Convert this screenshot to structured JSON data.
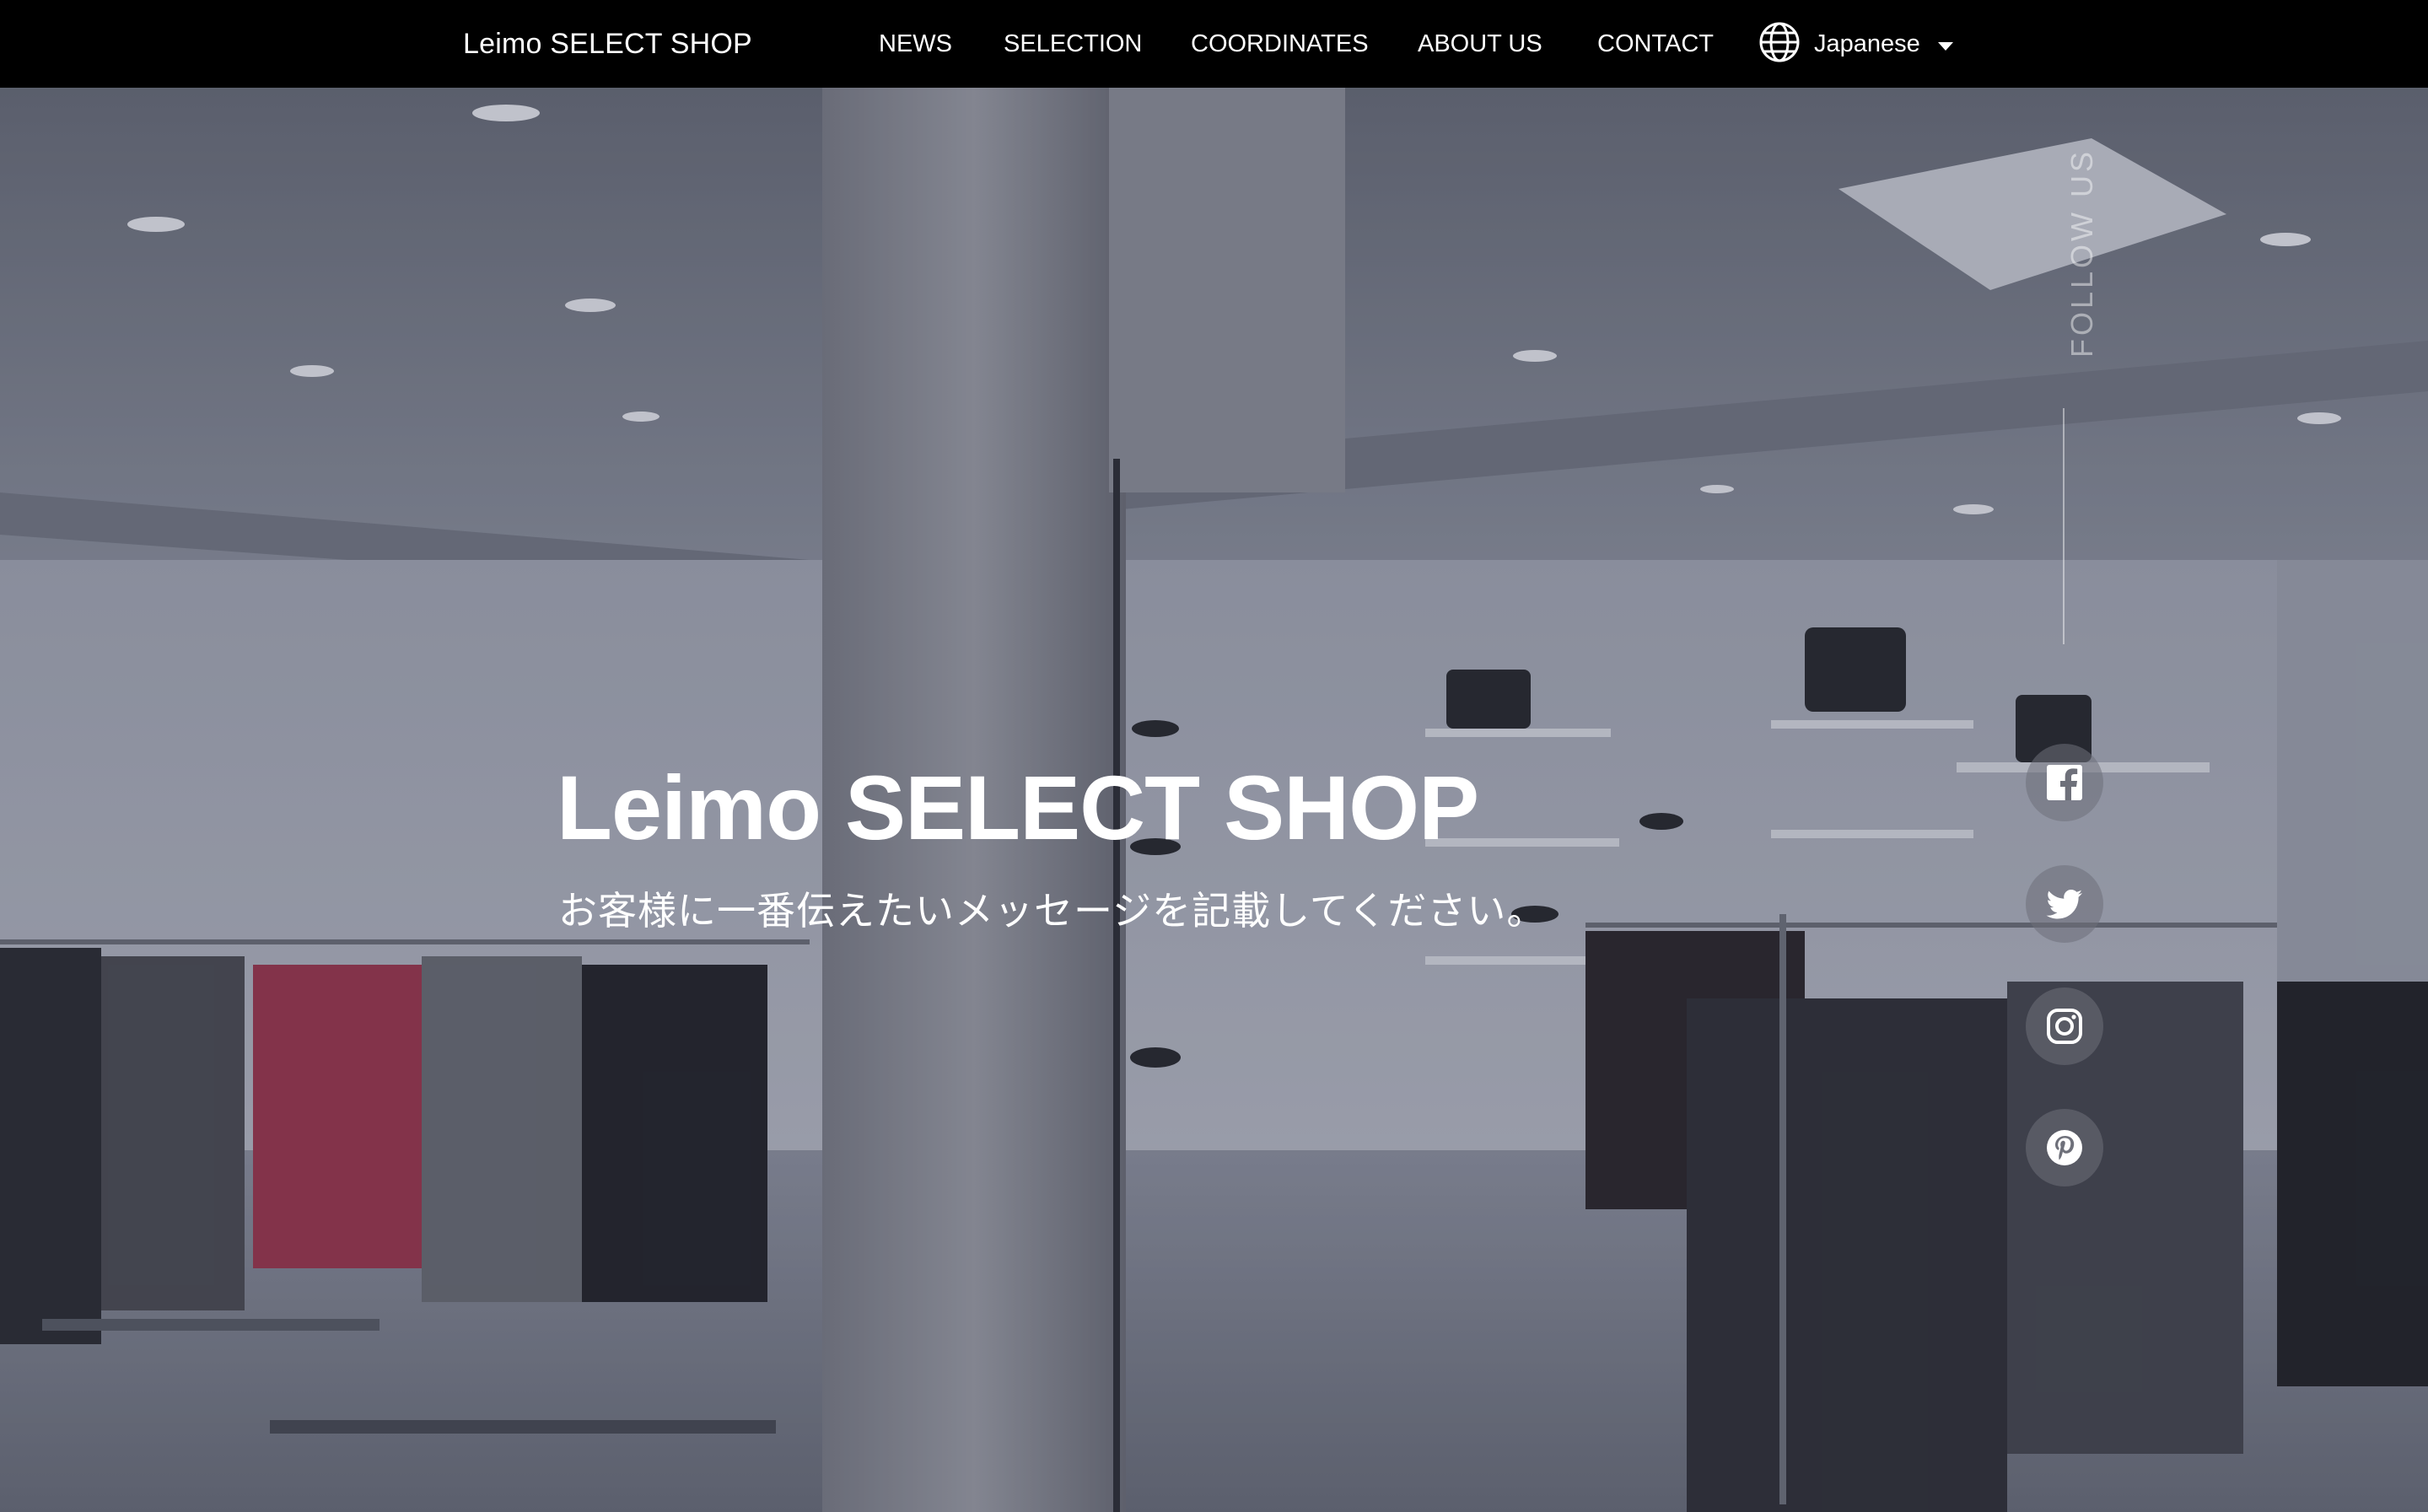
{
  "header": {
    "logo": "Leimo SELECT SHOP",
    "nav": [
      "NEWS",
      "SELECTION",
      "COORDINATES",
      "ABOUT US",
      "CONTACT"
    ],
    "language": {
      "label": "Japanese",
      "icon": "globe-icon"
    }
  },
  "hero": {
    "background_image": "clothing-store-interior-photo",
    "title": "Leimo SELECT SHOP",
    "subtitle": "お客様に一番伝えたいメッセージを記載してください。"
  },
  "follow": {
    "label": "FOLLOW US",
    "icons": [
      "facebook-icon",
      "twitter-icon",
      "instagram-icon",
      "pinterest-icon"
    ]
  },
  "colors": {
    "header_bg": "#000000",
    "text": "#ffffff"
  }
}
